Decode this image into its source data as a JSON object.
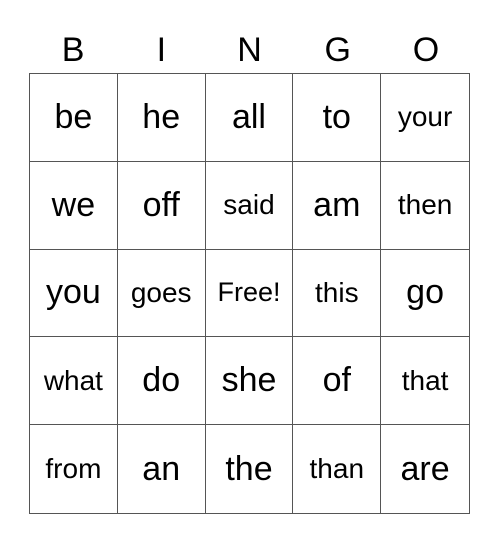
{
  "header": [
    "B",
    "I",
    "N",
    "G",
    "O"
  ],
  "rows": [
    [
      "be",
      "he",
      "all",
      "to",
      "your"
    ],
    [
      "we",
      "off",
      "said",
      "am",
      "then"
    ],
    [
      "you",
      "goes",
      "Free!",
      "this",
      "go"
    ],
    [
      "what",
      "do",
      "she",
      "of",
      "that"
    ],
    [
      "from",
      "an",
      "the",
      "than",
      "are"
    ]
  ]
}
